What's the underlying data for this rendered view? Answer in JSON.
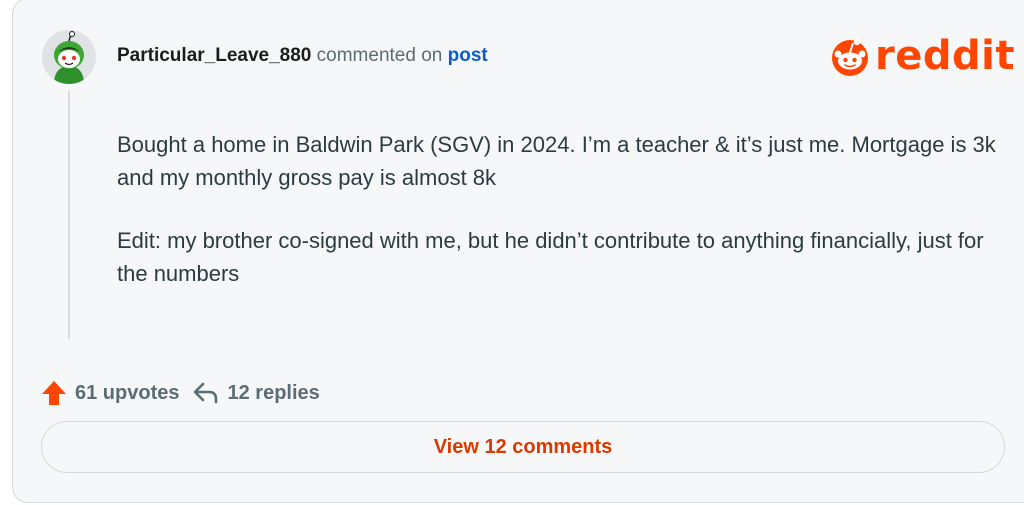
{
  "comment": {
    "author": "Particular_Leave_880",
    "action_text": "commented on",
    "post_link_label": "post",
    "paragraphs": [
      "Bought a home in Baldwin Park (SGV) in 2024. I’m a teacher & it’s just me. Mortgage is 3k and my monthly gross pay is almost 8k",
      "Edit: my brother co-signed with me, but he didn’t contribute to anything financially, just for the numbers"
    ]
  },
  "brand": {
    "name": "reddit",
    "color": "#ff4500"
  },
  "stats": {
    "upvotes_label": "61 upvotes",
    "upvote_icon": "upvote-arrow-icon",
    "replies_label": "12 replies",
    "reply_icon": "reply-arrow-icon"
  },
  "footer": {
    "view_comments_label": "View 12 comments"
  },
  "colors": {
    "accent_orange": "#ff4500",
    "link_blue": "#0b5cc9",
    "view_button_text": "#d93a00",
    "avatar_green": "#3fa535"
  }
}
